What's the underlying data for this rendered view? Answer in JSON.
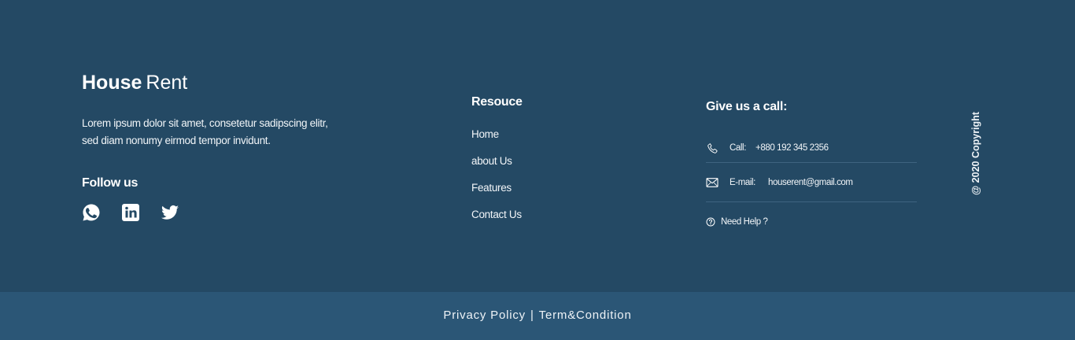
{
  "brand": {
    "name_bold": "House",
    "name_light": "Rent"
  },
  "about": {
    "description": "Lorem ipsum dolor sit amet, consetetur sadipscing elitr, sed diam nonumy eirmod tempor invidunt.",
    "follow_title": "Follow us",
    "social": [
      {
        "icon": "whatsapp-icon"
      },
      {
        "icon": "linkedin-icon"
      },
      {
        "icon": "twitter-icon"
      }
    ]
  },
  "resources": {
    "title": "Resouce",
    "links": [
      "Home",
      "about Us",
      "Features",
      "Contact Us"
    ]
  },
  "contact": {
    "title": "Give us a call:",
    "call_label": "Call:",
    "call_value": "+880 192 345 2356",
    "email_label": "E-mail:",
    "email_value": "houserent@gmail.com",
    "help_label": "Need Help ?"
  },
  "copyright": "@ 2020 Copyright",
  "legal": {
    "privacy": "Privacy Policy",
    "separator": "|",
    "terms": "Term&Condition"
  },
  "colors": {
    "background": "#244964",
    "bottom_bar": "#2b5676",
    "text": "#ffffff",
    "divider": "#3f6480"
  }
}
